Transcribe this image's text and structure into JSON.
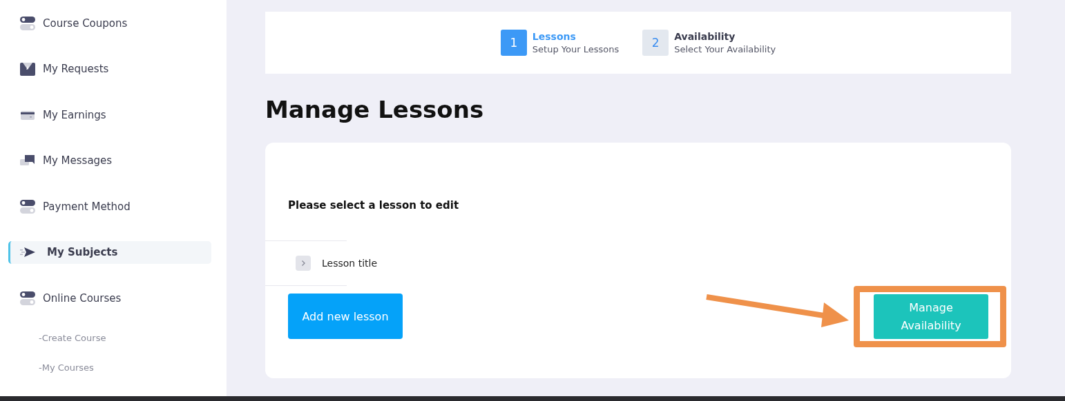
{
  "sidebar": {
    "items": [
      {
        "label": "Course Coupons",
        "kind": "toggle",
        "selected": false
      },
      {
        "label": "My Requests",
        "kind": "envelope",
        "selected": false
      },
      {
        "label": "My Earnings",
        "kind": "card",
        "selected": false
      },
      {
        "label": "My Messages",
        "kind": "chat",
        "selected": false
      },
      {
        "label": "Payment Method",
        "kind": "toggle",
        "selected": false
      },
      {
        "label": "My Subjects",
        "kind": "send",
        "selected": true
      },
      {
        "label": "Online Courses",
        "kind": "toggle",
        "selected": false,
        "children": [
          {
            "label": "-Create Course"
          },
          {
            "label": "-My Courses"
          }
        ]
      }
    ]
  },
  "steps": [
    {
      "number": "1",
      "title": "Lessons",
      "subtitle": "Setup Your Lessons",
      "selected": true
    },
    {
      "number": "2",
      "title": "Availability",
      "subtitle": "Select Your Availability",
      "selected": false
    }
  ],
  "heading": "Manage Lessons",
  "card": {
    "prompt": "Please select a lesson to edit",
    "lessons": [
      {
        "title": "Lesson title",
        "expanded": false
      }
    ],
    "add_button": "Add new lesson",
    "manage_button": "Manage Availability"
  }
}
